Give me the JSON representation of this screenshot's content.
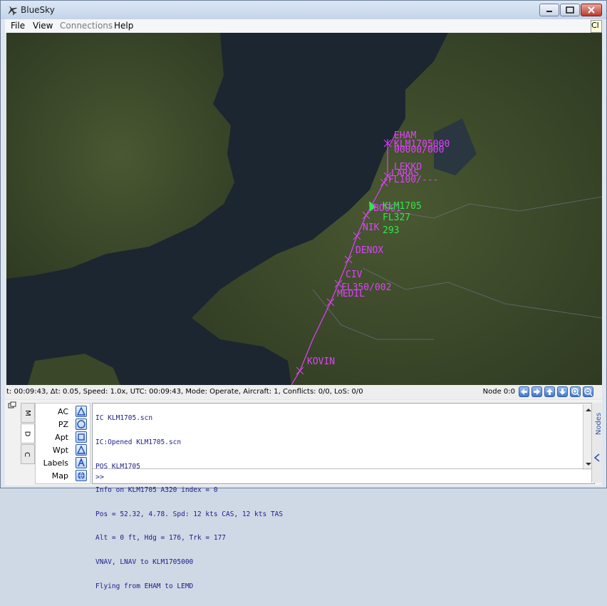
{
  "window": {
    "title": "BlueSky"
  },
  "menu": {
    "items": [
      "File",
      "View",
      "Connections",
      "Help"
    ],
    "clipped": "Cl"
  },
  "map": {
    "waypoints": [
      "EHAM",
      "LEKKO",
      "LARAS",
      "NIK",
      "DENOX",
      "CIV",
      "MEDIL",
      "KOVIN"
    ],
    "route_labels": [
      "KLM1705000",
      "00000/000",
      "FL100/---",
      "FL350/002"
    ],
    "aircraft": {
      "id": "KLM1705",
      "fl": "FL327",
      "speed": "293",
      "waypoint_overlap": "BOG01"
    }
  },
  "status": {
    "line": "t: 00:09:43, Δt: 0.05, Speed: 1.0x, UTC: 00:09:43, Mode: Operate, Aircraft: 1, Conflicts: 0/0, LoS: 0/0",
    "node": "Node 0:0"
  },
  "tabs": [
    "M",
    "D",
    "C"
  ],
  "layers": [
    {
      "label": "AC",
      "icon": "triangle-icon"
    },
    {
      "label": "PZ",
      "icon": "circle-icon"
    },
    {
      "label": "Apt",
      "icon": "square-icon"
    },
    {
      "label": "Wpt",
      "icon": "triangle-icon"
    },
    {
      "label": "Labels",
      "icon": "letter-a-icon"
    },
    {
      "label": "Map",
      "icon": "globe-icon"
    }
  ],
  "console": {
    "lines": [
      "IC KLM1705.scn",
      "IC:Opened KLM1705.scn",
      "POS KLM1705",
      "Info on KLM1705 A320 index = 0",
      "Pos = 52.32, 4.78. Spd: 12 kts CAS, 12 kts TAS",
      "Alt = 0 ft, Hdg = 176, Trk = 177",
      "VNAV, LNAV to KLM1705000",
      "Flying from EHAM to LEMD"
    ],
    "prompt": ">>"
  },
  "side_tab": "Nodes",
  "colors": {
    "route": "#e040ff",
    "aircraft": "#2ee84a",
    "sea": "#1a2530",
    "land": "#3d4a2a"
  }
}
